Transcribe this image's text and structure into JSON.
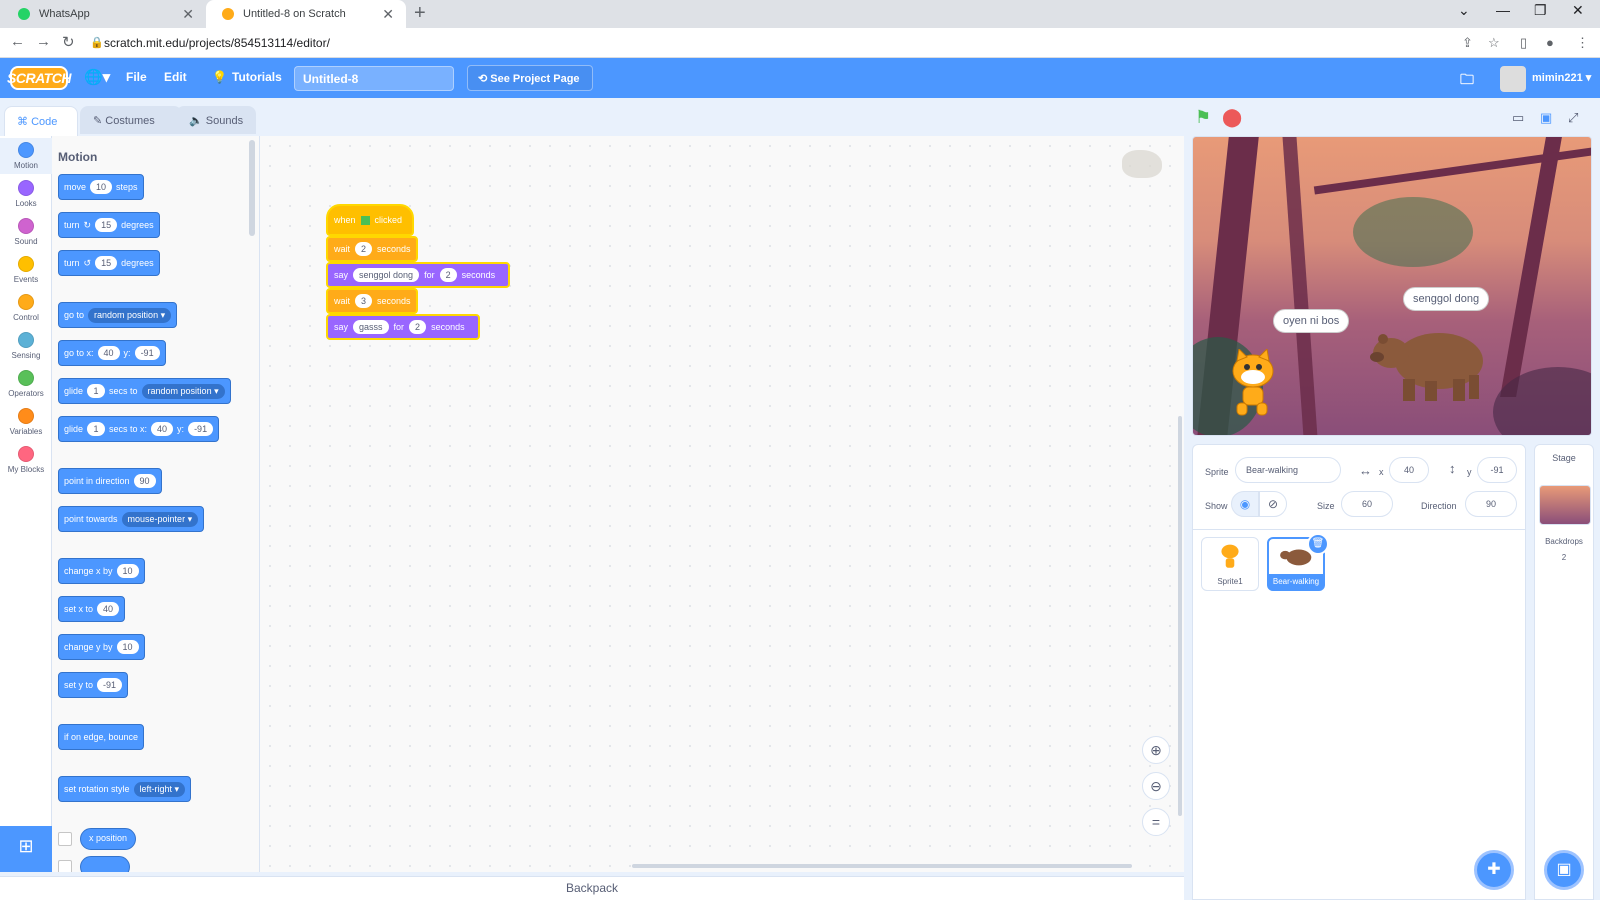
{
  "browser": {
    "tabs": [
      {
        "title": "WhatsApp",
        "favicon_color": "#25d366"
      },
      {
        "title": "Untitled-8 on Scratch",
        "favicon_color": "#ffab19"
      }
    ],
    "url": "scratch.mit.edu/projects/854513114/editor/"
  },
  "menubar": {
    "logo": "SCRATCH",
    "file": "File",
    "edit": "Edit",
    "tutorials": "Tutorials",
    "project_title": "Untitled-8",
    "see_project": "See Project Page",
    "username": "mimin221"
  },
  "editor_tabs": [
    "Code",
    "Costumes",
    "Sounds"
  ],
  "categories": [
    {
      "name": "Motion",
      "color": "#4c97ff"
    },
    {
      "name": "Looks",
      "color": "#9966ff"
    },
    {
      "name": "Sound",
      "color": "#cf63cf"
    },
    {
      "name": "Events",
      "color": "#ffbf00"
    },
    {
      "name": "Control",
      "color": "#ffab19"
    },
    {
      "name": "Sensing",
      "color": "#5cb1d6"
    },
    {
      "name": "Operators",
      "color": "#59c059"
    },
    {
      "name": "Variables",
      "color": "#ff8c1a"
    },
    {
      "name": "My Blocks",
      "color": "#ff6680"
    }
  ],
  "palette": {
    "heading": "Motion",
    "move": {
      "a": "move",
      "v": "10",
      "b": "steps"
    },
    "turn_right": {
      "a": "turn",
      "v": "15",
      "b": "degrees"
    },
    "turn_left": {
      "a": "turn",
      "v": "15",
      "b": "degrees"
    },
    "goto": {
      "a": "go to",
      "dd": "random position"
    },
    "goto_xy": {
      "a": "go to x:",
      "x": "40",
      "b": "y:",
      "y": "-91"
    },
    "glide_to": {
      "a": "glide",
      "v": "1",
      "b": "secs to",
      "dd": "random position"
    },
    "glide_xy": {
      "a": "glide",
      "v": "1",
      "b": "secs to x:",
      "x": "40",
      "c": "y:",
      "y": "-91"
    },
    "point_dir": {
      "a": "point in direction",
      "v": "90"
    },
    "point_towards": {
      "a": "point towards",
      "dd": "mouse-pointer"
    },
    "change_x": {
      "a": "change x by",
      "v": "10"
    },
    "set_x": {
      "a": "set x to",
      "v": "40"
    },
    "change_y": {
      "a": "change y by",
      "v": "10"
    },
    "set_y": {
      "a": "set y to",
      "v": "-91"
    },
    "bounce": "if on edge, bounce",
    "rot_style": {
      "a": "set rotation style",
      "dd": "left-right"
    },
    "xpos": "x position"
  },
  "script": {
    "hat": {
      "a": "when",
      "b": "clicked"
    },
    "wait1": {
      "a": "wait",
      "v": "2",
      "b": "seconds"
    },
    "say1": {
      "a": "say",
      "msg": "senggol dong",
      "b": "for",
      "v": "2",
      "c": "seconds"
    },
    "wait2": {
      "a": "wait",
      "v": "3",
      "b": "seconds"
    },
    "say2": {
      "a": "say",
      "msg": "gasss",
      "b": "for",
      "v": "2",
      "c": "seconds"
    }
  },
  "backpack": "Backpack",
  "stage": {
    "bubble_cat": "oyen ni bos",
    "bubble_bear": "senggol dong"
  },
  "sprite_info": {
    "sprite_label": "Sprite",
    "sprite_name": "Bear-walking",
    "x_label": "x",
    "x": "40",
    "y_label": "y",
    "y": "-91",
    "show_label": "Show",
    "size_label": "Size",
    "size": "60",
    "direction_label": "Direction",
    "direction": "90"
  },
  "sprites": [
    {
      "name": "Sprite1"
    },
    {
      "name": "Bear-walking"
    }
  ],
  "stage_pane": {
    "label": "Stage",
    "backdrops_label": "Backdrops",
    "backdrops_count": "2"
  }
}
